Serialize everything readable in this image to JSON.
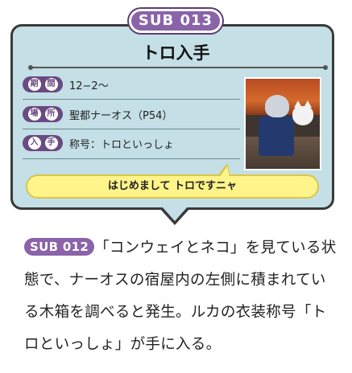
{
  "card": {
    "badge": "SUB 013",
    "title": "トロ入手",
    "rows": [
      {
        "pill_chars": [
          "期",
          "間"
        ],
        "value": "12−2～"
      },
      {
        "pill_chars": [
          "場",
          "所"
        ],
        "value": "聖都ナーオス（P54）"
      },
      {
        "pill_chars": [
          "入",
          "手"
        ],
        "value": "称号：トロといっしょ"
      }
    ],
    "speech": "はじめまして トロですニャ"
  },
  "body": {
    "ref_badge": "SUB 012",
    "text": "「コンウェイとネコ」を見ている状態で、ナーオスの宿屋内の左側に積まれている木箱を調べると発生。ルカの衣装称号「トロといっしょ」が手に入る。"
  },
  "colors": {
    "card_bg": "#c4dfe5",
    "badge_purple": "#8a63a8",
    "speech_yellow": "#fff48a"
  }
}
